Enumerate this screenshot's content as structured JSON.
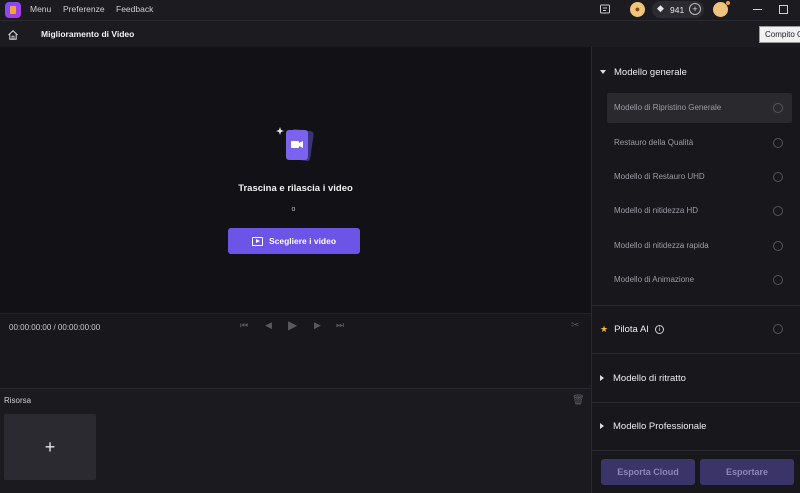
{
  "titlebar": {
    "menu_items": [
      "Menu",
      "Preferenze",
      "Feedback"
    ],
    "credits": "941"
  },
  "header": {
    "title": "Miglioramento di Video",
    "tooltip": "Compito Cloud"
  },
  "preview": {
    "drop_title": "Trascina e rilascia i video",
    "or_text": "o",
    "choose_button": "Scegliere i video"
  },
  "controls": {
    "timecode": "00:00:00:00 / 00:00:00:00"
  },
  "resource": {
    "title": "Risorsa",
    "add_symbol": "+"
  },
  "panel": {
    "general_model": {
      "title": "Modello generale",
      "options": [
        {
          "label": "Modello di Ripristino Generale",
          "active": true
        },
        {
          "label": "Restauro della Qualità",
          "active": false
        },
        {
          "label": "Modello di Restauro UHD",
          "active": false
        },
        {
          "label": "Modello di nitidezza HD",
          "active": false
        },
        {
          "label": "Modello di nitidezza rapida",
          "active": false
        },
        {
          "label": "Modello di Animazione",
          "active": false
        }
      ]
    },
    "pilot_ai": "Pilota AI",
    "portrait_model": "Modello di ritratto",
    "professional_model": "Modello Professionale",
    "export_cloud": "Esporta Cloud",
    "export": "Esportare"
  },
  "colors": {
    "accent": "#6b54e6",
    "star": "#f1b73b",
    "disabled_button": "#3a3468"
  },
  "icons": [
    "home-icon",
    "star-icon",
    "info-icon",
    "trash-icon",
    "scissors-icon",
    "play-icon",
    "video-file-icon"
  ]
}
